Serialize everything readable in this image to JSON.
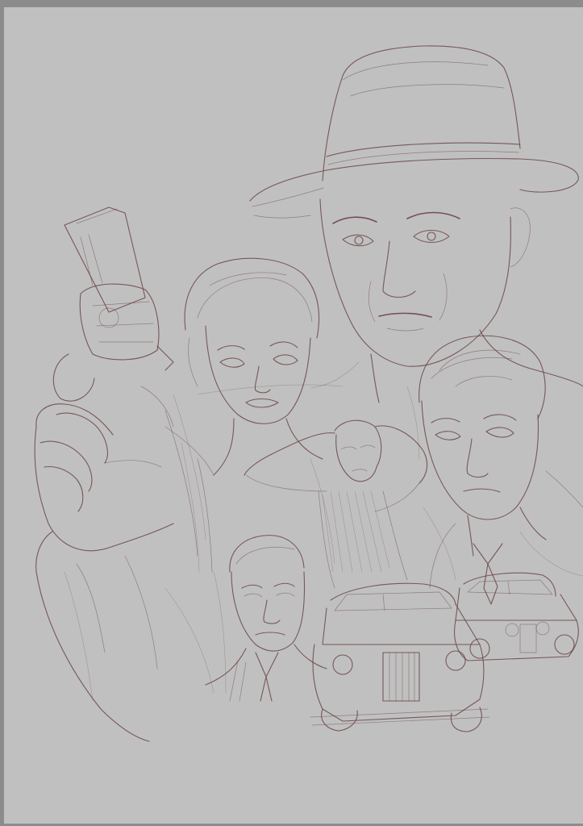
{
  "canvas": {
    "background_color": "#c0c0c0",
    "frame_color": "#8c8c8c",
    "stroke_color": "#6b4447"
  },
  "artwork": {
    "medium": "pencil sketch",
    "elements": [
      "man-in-fedora",
      "woman-with-bun",
      "young-man",
      "woman-arms-raised",
      "older-man",
      "hand-with-revolver",
      "vintage-car-front",
      "vintage-car-right"
    ]
  }
}
